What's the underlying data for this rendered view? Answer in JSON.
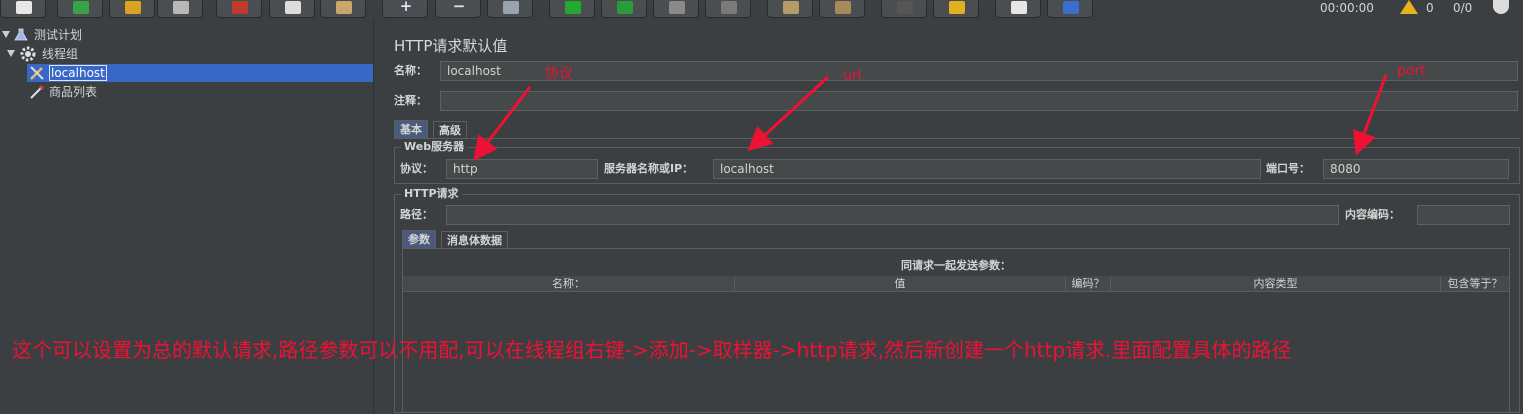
{
  "toolbar": {
    "timer": "00:00:00",
    "warning_count": "0",
    "thread_ratio": "0/0",
    "buttons": [
      {
        "icon": "new-icon",
        "color": "#e8e8e8"
      },
      {
        "icon": "templates-icon",
        "color": "#3aa34a"
      },
      {
        "icon": "open-icon",
        "color": "#d9a520"
      },
      {
        "icon": "save-icon",
        "color": "#b8b8b8"
      },
      {
        "icon": "cut-icon",
        "color": "#c03a2b"
      },
      {
        "icon": "copy-icon",
        "color": "#dcdcdc"
      },
      {
        "icon": "paste-icon",
        "color": "#c9a76a"
      },
      {
        "icon": "expand-icon",
        "label": "+"
      },
      {
        "icon": "collapse-icon",
        "label": "−"
      },
      {
        "icon": "toggle-icon",
        "color": "#9aa3ad"
      },
      {
        "icon": "start-icon",
        "color": "#25a82f"
      },
      {
        "icon": "start-no-pause-icon",
        "color": "#2a9c3a"
      },
      {
        "icon": "stop-icon",
        "color": "#8a8a8a"
      },
      {
        "icon": "shutdown-icon",
        "color": "#7a7a7a"
      },
      {
        "icon": "clear-icon",
        "color": "#b59a6a"
      },
      {
        "icon": "clear-all-icon",
        "color": "#a68a5a"
      },
      {
        "icon": "search-icon",
        "color": "#555555"
      },
      {
        "icon": "reset-search-icon",
        "color": "#e0b020"
      },
      {
        "icon": "function-helper-icon",
        "color": "#e6e6e6"
      },
      {
        "icon": "help-icon",
        "color": "#3a6fd0"
      }
    ]
  },
  "tree": {
    "items": [
      {
        "label": "测试计划",
        "icon": "flask-icon"
      },
      {
        "label": "线程组",
        "icon": "gear-icon"
      },
      {
        "label": "localhost",
        "icon": "wrench-icon",
        "selected": true
      },
      {
        "label": "商品列表",
        "icon": "pipette-icon"
      }
    ]
  },
  "panel": {
    "title": "HTTP请求默认值",
    "name_label": "名称：",
    "name_value": "localhost",
    "comment_label": "注释：",
    "comment_value": "",
    "tabs": [
      "基本",
      "高级"
    ],
    "web_server": {
      "title": "Web服务器",
      "protocol_label": "协议：",
      "protocol_value": "http",
      "server_label": "服务器名称或IP：",
      "server_value": "localhost",
      "port_label": "端口号：",
      "port_value": "8080"
    },
    "http_request": {
      "title": "HTTP请求",
      "path_label": "路径：",
      "path_value": "",
      "encoding_label": "内容编码：",
      "encoding_value": ""
    },
    "sub_tabs": [
      "参数",
      "消息体数据"
    ],
    "params": {
      "caption": "同请求一起发送参数：",
      "columns": [
        "名称：",
        "值",
        "编码？",
        "内容类型",
        "包含等于？"
      ]
    }
  },
  "annotations": {
    "protocol_note": "协议",
    "url_note": "url",
    "port_note": "port",
    "caption": "这个可以设置为总的默认请求,路径参数可以不用配,可以在线程组右键->添加->取样器->http请求,然后新创建一个http请求.里面配置具体的路径",
    "color": "#ee1133"
  }
}
